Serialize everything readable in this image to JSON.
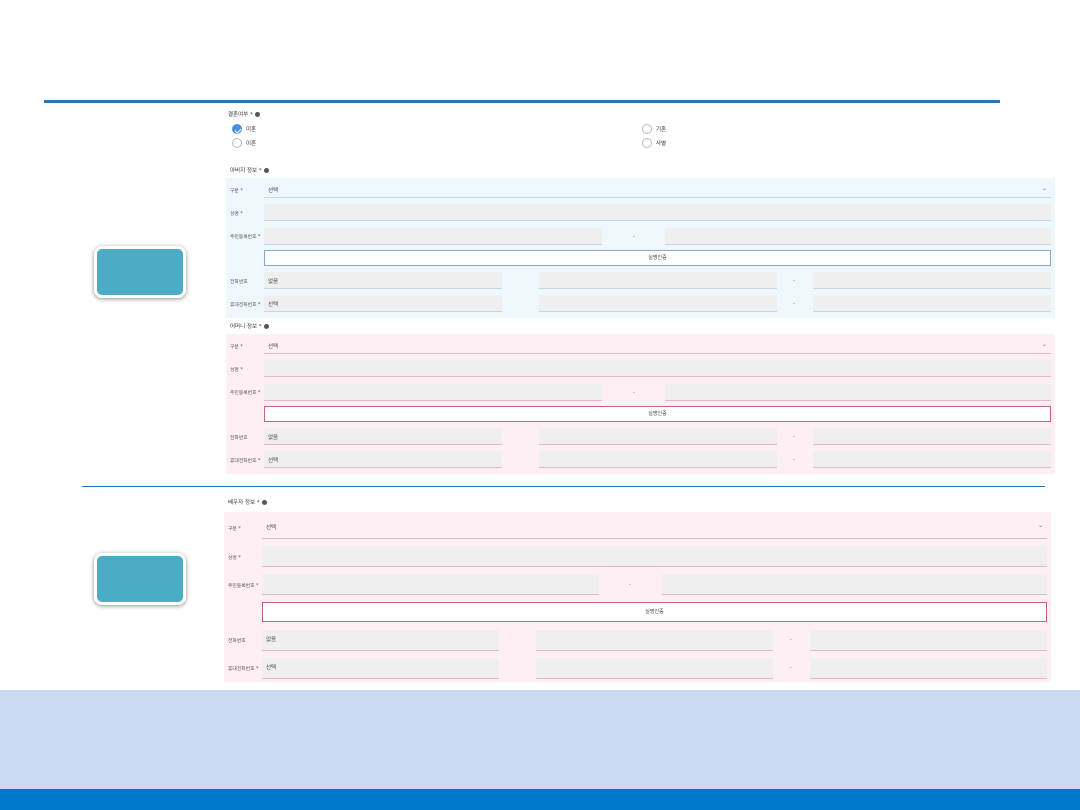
{
  "marital": {
    "title": "결혼여부 *",
    "options": [
      {
        "label": "미혼",
        "checked": true
      },
      {
        "label": "기혼",
        "checked": false
      },
      {
        "label": "이혼",
        "checked": false
      },
      {
        "label": "사별",
        "checked": false
      }
    ]
  },
  "father": {
    "title": "아버지 정보 *",
    "type_label": "구분 *",
    "type_value": "선택",
    "name_label": "성명 *",
    "rrn_label": "주민등록번호 *",
    "rrn_dash": "-",
    "auth_button": "실명인증",
    "phone_label": "전화번호",
    "phone_value": "없음",
    "mobile_label": "휴대전화번호 *",
    "mobile_value": "선택",
    "dash": "-"
  },
  "mother": {
    "title": "어머니 정보 *",
    "type_label": "구분 *",
    "type_value": "선택",
    "name_label": "성명 *",
    "rrn_label": "주민등록번호 *",
    "rrn_dash": "-",
    "auth_button": "실명인증",
    "phone_label": "전화번호",
    "phone_value": "없음",
    "mobile_label": "휴대전화번호 *",
    "mobile_value": "선택",
    "dash": "-"
  },
  "spouse": {
    "title": "배우자 정보 *",
    "type_label": "구분 *",
    "type_value": "선택",
    "name_label": "성명 *",
    "rrn_label": "주민등록번호 *",
    "rrn_dash": "-",
    "auth_button": "실명인증",
    "phone_label": "전화번호",
    "phone_value": "없음",
    "mobile_label": "휴대전화번호 *",
    "mobile_value": "선택",
    "dash": "-"
  },
  "colors": {
    "accent_rule": "#2e75b6",
    "teal_button": "#4bacc6",
    "father_bg": "#eef7fc",
    "mother_bg": "#fdeff3",
    "bottom_band": "#c9d9ef",
    "bottom_bar": "#0077c8",
    "radio_checked": "#4a90e2"
  }
}
